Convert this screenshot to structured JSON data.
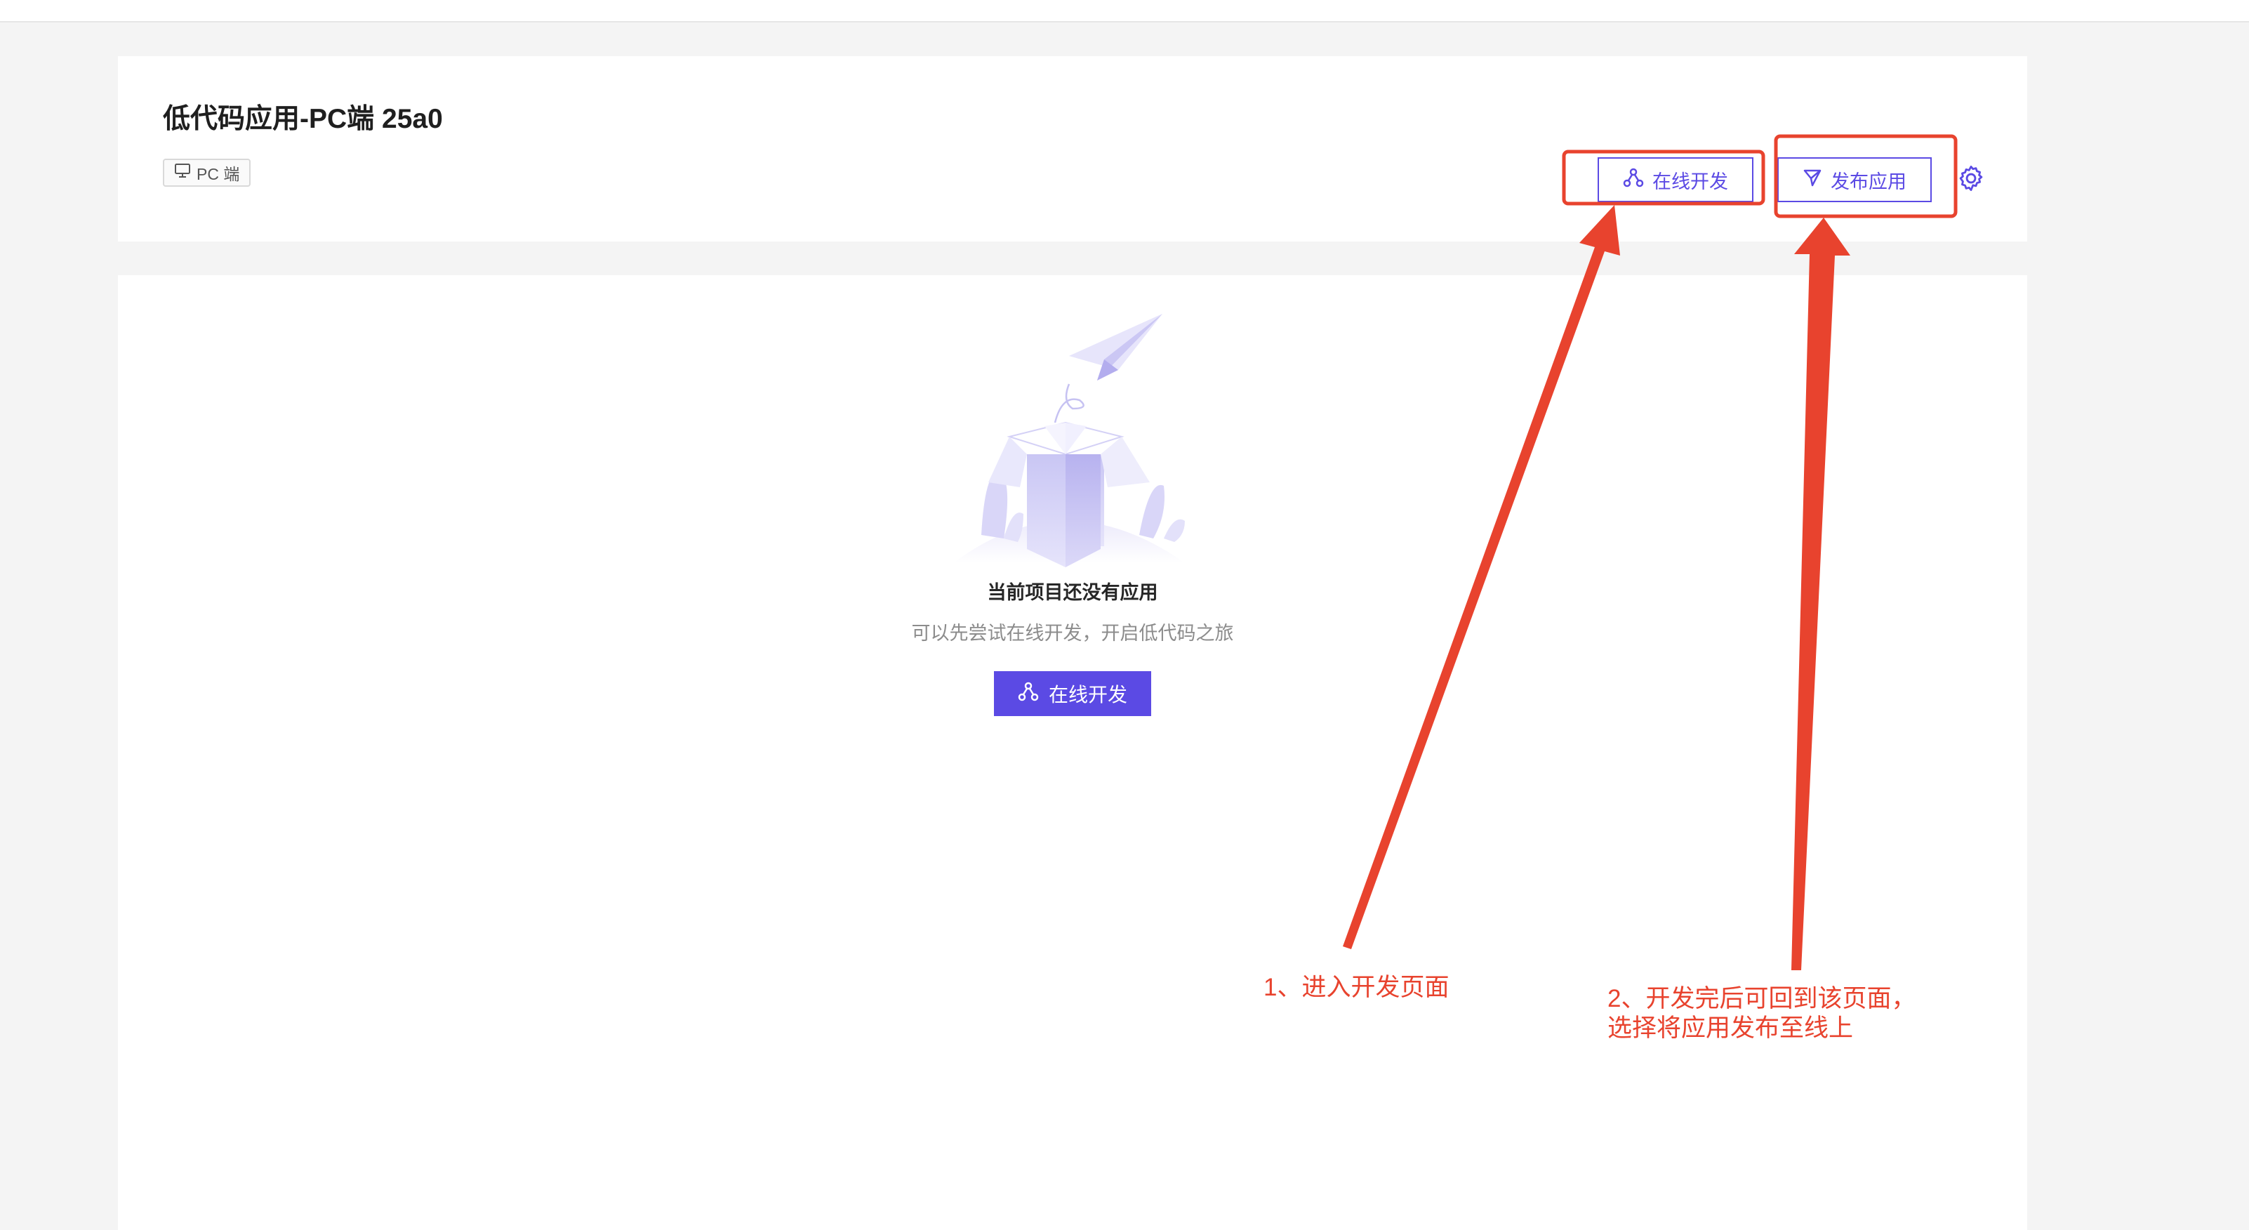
{
  "app": {
    "title": "低代码应用-PC端 25a0",
    "platform_tag": "PC 端"
  },
  "header": {
    "dev_button_label": "在线开发",
    "publish_button_label": "发布应用",
    "settings_icon": "gear-icon"
  },
  "empty_state": {
    "title": "当前项目还没有应用",
    "subtitle": "可以先尝试在线开发，开启低代码之旅",
    "button_label": "在线开发",
    "illustration": "open-box-paper-plane"
  },
  "annotations": {
    "note1": "1、进入开发页面",
    "note2_line1": "2、开发完后可回到该页面，",
    "note2_line2": "选择将应用发布至线上",
    "color": "#e8432e"
  },
  "colors": {
    "accent": "#5b4ae4",
    "annotation": "#e8432e",
    "background": "#f4f4f4"
  }
}
